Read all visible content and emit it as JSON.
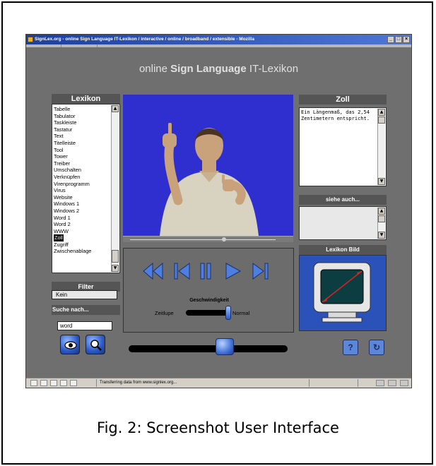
{
  "browser": {
    "title": "SignLex.org - online Sign Language IT-Lexikon / interactive / online / broadband / extensible - Mozilla",
    "status_text": "Transferring data from www.signlex.org..."
  },
  "app": {
    "heading_prefix": "online ",
    "heading_bold": "Sign Language",
    "heading_suffix": " IT-Lexikon"
  },
  "lexikon": {
    "title": "Lexikon",
    "items": [
      "Tabelle",
      "Tabulator",
      "Taskleiste",
      "Tastatur",
      "Text",
      "Titelleiste",
      "Tool",
      "Tower",
      "Treiber",
      "Umschalten",
      "Verknüpfen",
      "Virenprogramm",
      "Virus",
      "Website",
      "Windows 1",
      "Windows 2",
      "Word 1",
      "Word 2",
      "WWW",
      "Zoll",
      "Zugriff",
      "Zwischenablage"
    ],
    "selected": "Zoll"
  },
  "filter": {
    "title": "Filter",
    "value": "Kein"
  },
  "search": {
    "label": "Suche nach...",
    "value": "word"
  },
  "player": {
    "speed_label": "Geschwindigkeit",
    "speed_min_label": "Zeitlupe",
    "speed_max_label": "Normal",
    "speed_level": 1.0,
    "volume_level": 0.6,
    "video_position": 0.61
  },
  "entry": {
    "word": "Zoll",
    "definition": "Ein Längenmaß, das 2,54 Zentimetern entspricht.",
    "see_also_title": "siehe auch...",
    "image_title": "Lexikon Bild"
  },
  "caption": "Fig. 2: Screenshot User Interface",
  "icons": [
    "app-icon",
    "eye-icon",
    "search-icon",
    "rewind-icon",
    "previous-icon",
    "pause-icon",
    "play-icon",
    "next-icon",
    "help-icon",
    "back-icon"
  ]
}
